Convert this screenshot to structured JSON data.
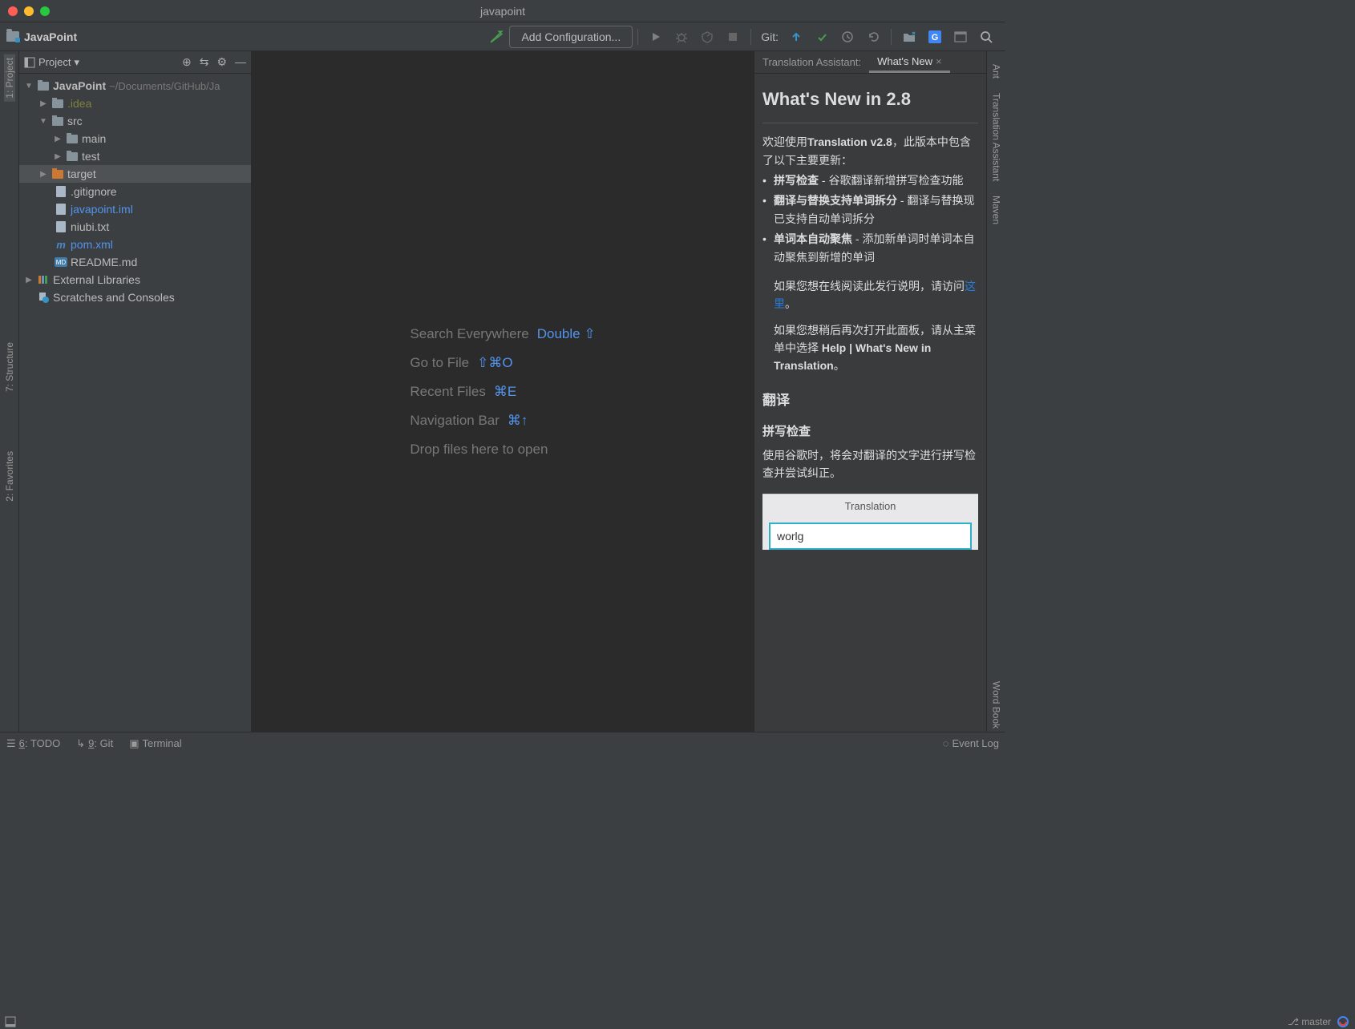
{
  "window": {
    "title": "javapoint"
  },
  "breadcrumb": {
    "project": "JavaPoint"
  },
  "toolbar": {
    "add_config": "Add Configuration...",
    "git_label": "Git:"
  },
  "project_pane": {
    "label": "Project"
  },
  "tree": {
    "root": {
      "name": "JavaPoint",
      "path": "~/Documents/GitHub/Ja"
    },
    "idea": ".idea",
    "src": "src",
    "main": "main",
    "test": "test",
    "target": "target",
    "gitignore": ".gitignore",
    "iml": "javapoint.iml",
    "niubi": "niubi.txt",
    "pom": "pom.xml",
    "readme": "README.md",
    "external": "External Libraries",
    "scratches": "Scratches and Consoles"
  },
  "hints": {
    "search": {
      "label": "Search Everywhere",
      "shortcut": "Double ⇧"
    },
    "gotofile": {
      "label": "Go to File",
      "shortcut": "⇧⌘O"
    },
    "recent": {
      "label": "Recent Files",
      "shortcut": "⌘E"
    },
    "navbar": {
      "label": "Navigation Bar",
      "shortcut": "⌘↑"
    },
    "drop": "Drop files here to open"
  },
  "right_tabs": {
    "translation": "Translation Assistant:",
    "whatsnew": "What's New"
  },
  "whatsnew": {
    "title": "What's New in 2.8",
    "intro_a": "欢迎使用",
    "intro_b": "Translation v2.8",
    "intro_c": "，此版本中包含了以下主要更新：",
    "b1a": "拼写检查",
    "b1b": " - 谷歌翻译新增拼写检查功能",
    "b2a": "翻译与替换支持单词拆分",
    "b2b": " - 翻译与替换现已支持自动单词拆分",
    "b3a": "单词本自动聚焦",
    "b3b": " - 添加新单词时单词本自动聚焦到新增的单词",
    "note1a": "如果您想在线阅读此发行说明，请访问",
    "note1b": "这里",
    "note1c": "。",
    "note2a": "如果您想稍后再次打开此面板，请从主菜单中选择 ",
    "note2b": "Help | What's New in Translation",
    "note2c": "。",
    "h2_translate": "翻译",
    "h3_spell": "拼写检查",
    "spell_desc": "使用谷歌时，将会对翻译的文字进行拼写检查并尝试纠正。",
    "preview_head": "Translation",
    "preview_input": "worlg"
  },
  "stripes": {
    "project": "1: Project",
    "structure": "7: Structure",
    "favorites": "2: Favorites",
    "ant": "Ant",
    "translation_assistant": "Translation Assistant",
    "maven": "Maven",
    "word_book": "Word Book"
  },
  "bottom": {
    "todo": {
      "u": "6",
      "rest": ": TODO"
    },
    "git": {
      "u": "9",
      "rest": ": Git"
    },
    "terminal": "Terminal",
    "event_log": "Event Log"
  },
  "status": {
    "branch": "master"
  }
}
